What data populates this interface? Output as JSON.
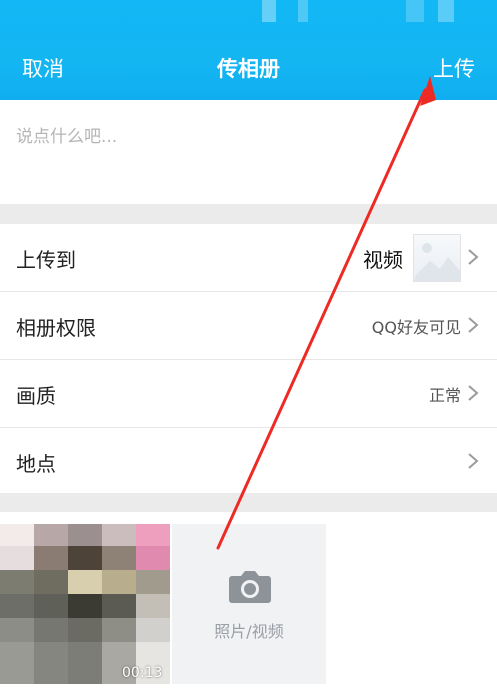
{
  "header": {
    "cancel_label": "取消",
    "title": "传相册",
    "upload_label": "上传"
  },
  "caption": {
    "placeholder": "说点什么吧..."
  },
  "settings": {
    "rows": [
      {
        "label": "上传到",
        "value": "视频"
      },
      {
        "label": "相册权限",
        "value": "QQ好友可见"
      },
      {
        "label": "画质",
        "value": "正常"
      },
      {
        "label": "地点",
        "value": ""
      }
    ]
  },
  "media": {
    "video_duration": "00:13",
    "add_tile_label": "照片/视频"
  },
  "colors": {
    "header": "#12b7f5",
    "annotation_arrow": "#ee2a24"
  },
  "icons": {
    "chevron": "chevron-right-icon",
    "camera": "camera-icon"
  }
}
